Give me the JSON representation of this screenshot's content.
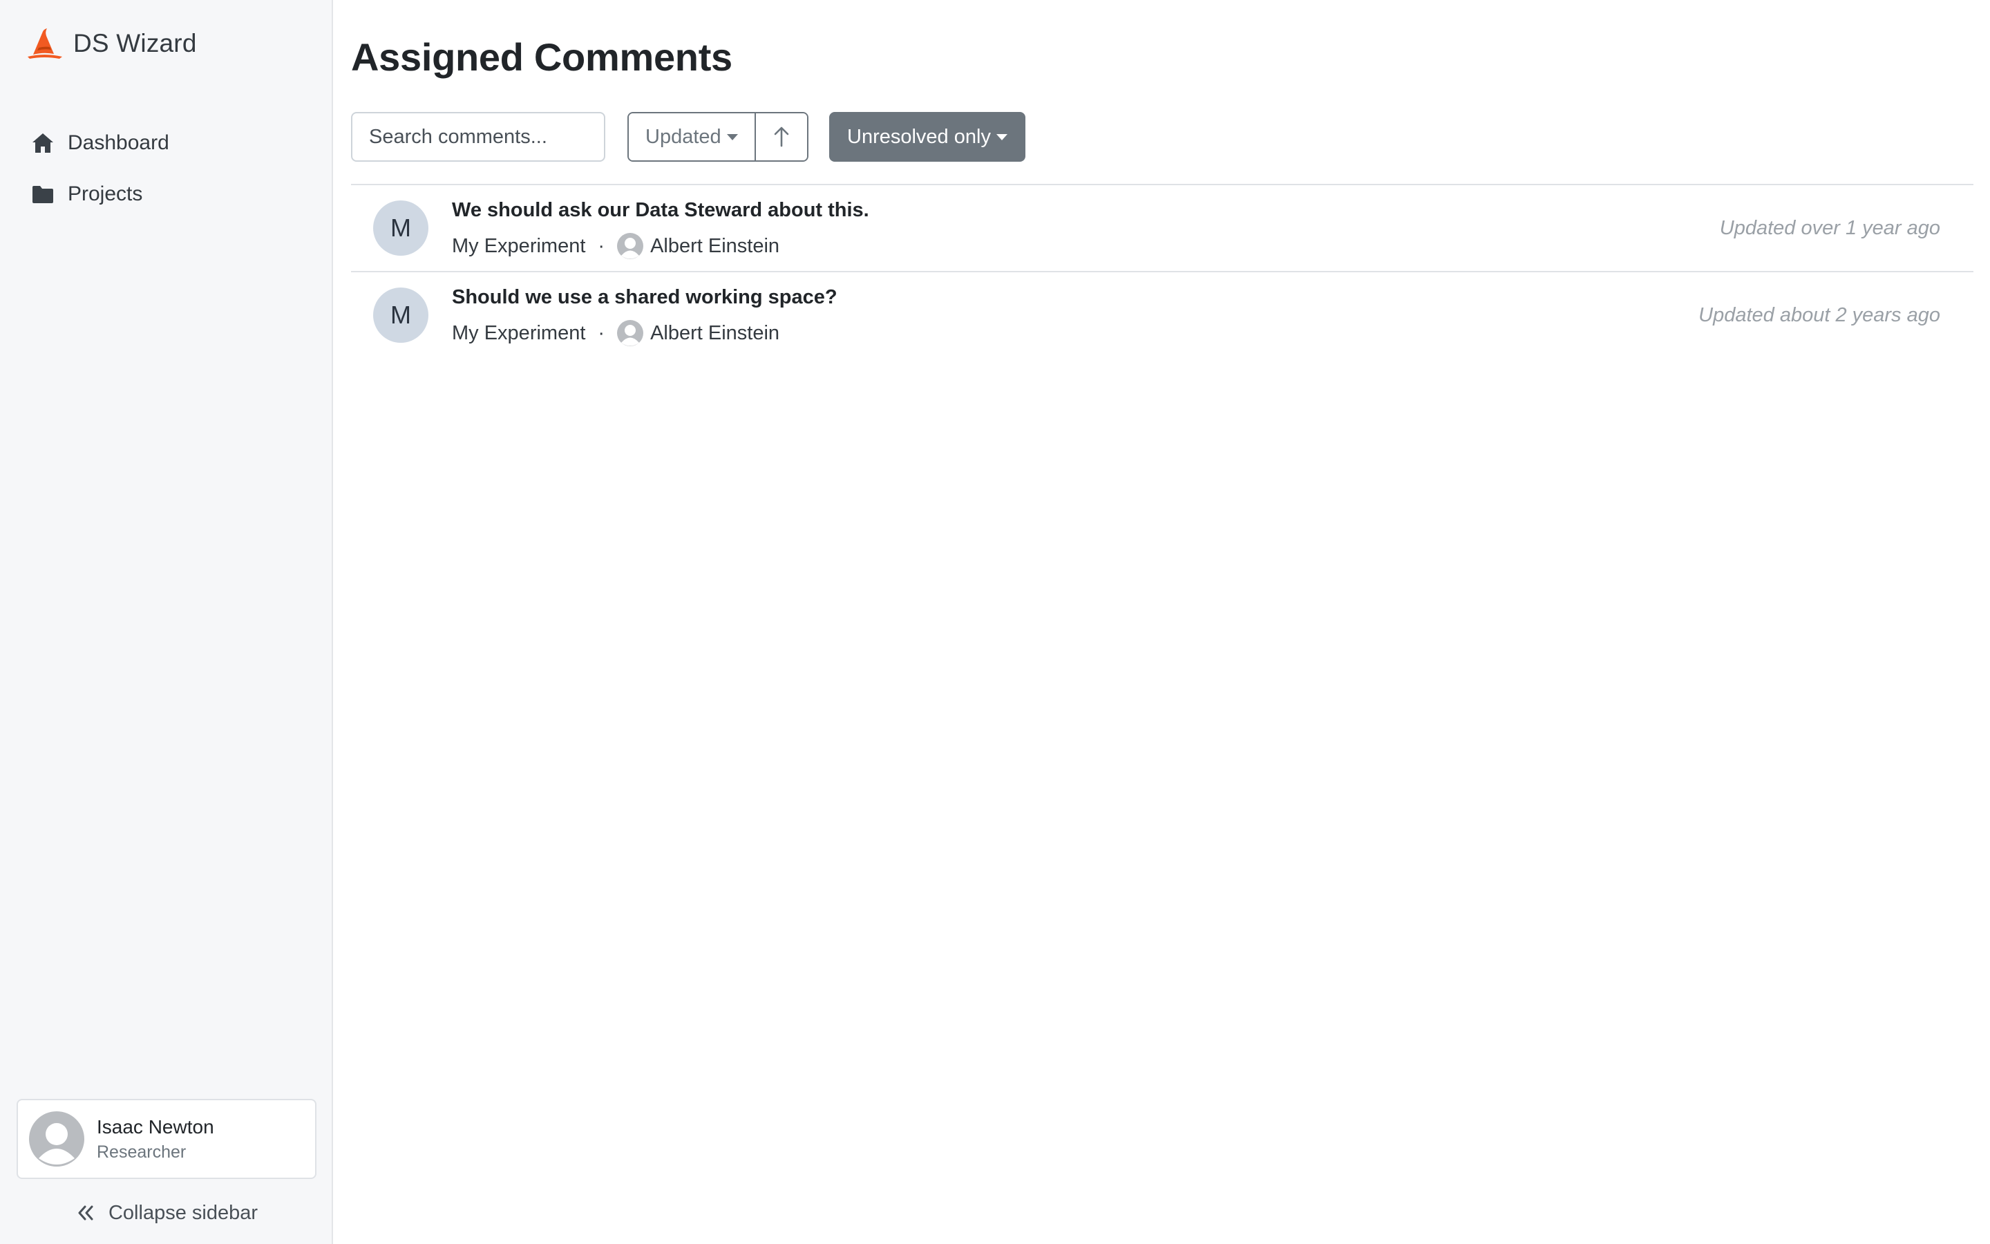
{
  "app": {
    "name": "DS Wizard",
    "brand_color": "#f15a22"
  },
  "sidebar": {
    "nav": [
      {
        "label": "Dashboard",
        "icon": "home-icon"
      },
      {
        "label": "Projects",
        "icon": "folder-icon"
      }
    ],
    "profile": {
      "name": "Isaac Newton",
      "role": "Researcher",
      "icon": "avatar-placeholder-icon"
    },
    "collapse_label": "Collapse sidebar",
    "collapse_icon": "double-chevron-left-icon"
  },
  "main": {
    "title": "Assigned Comments",
    "search": {
      "placeholder": "Search comments...",
      "value": ""
    },
    "sort": {
      "label": "Updated",
      "direction_icon": "arrow-up-icon"
    },
    "filter": {
      "label": "Unresolved only",
      "color": "#6c757d"
    },
    "comments": [
      {
        "avatar_letter": "M",
        "title": "We should ask our Data Steward about this.",
        "project": "My Experiment",
        "separator": "·",
        "user": "Albert Einstein",
        "updated": "Updated over 1 year ago"
      },
      {
        "avatar_letter": "M",
        "title": "Should we use a shared working space?",
        "project": "My Experiment",
        "separator": "·",
        "user": "Albert Einstein",
        "updated": "Updated about 2 years ago"
      }
    ]
  }
}
